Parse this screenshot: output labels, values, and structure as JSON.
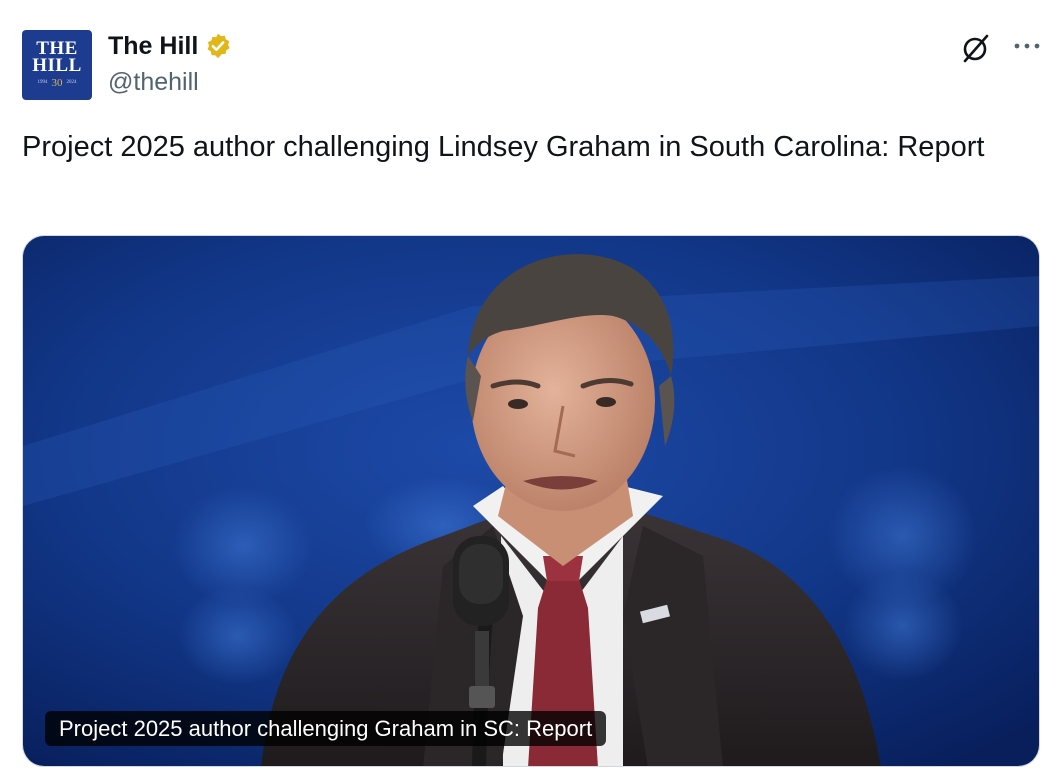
{
  "author": {
    "name": "The Hill",
    "handle": "@thehill",
    "verified": true,
    "avatar": {
      "line1": "THE",
      "line2": "HILL",
      "year_left": "1994",
      "anniversary": "30",
      "year_right": "2024",
      "bg_color": "#1d3c8f"
    }
  },
  "icons": {
    "grok": "grok-icon",
    "more": "more-icon",
    "verified": "verified-badge-icon"
  },
  "tweet": {
    "text": "Project 2025 author challenging Lindsey Graham in South Carolina: Report"
  },
  "media": {
    "caption": "Project 2025 author challenging Graham in SC: Report"
  },
  "colors": {
    "text": "#0f1419",
    "secondary": "#536471",
    "badge": "#e2b719"
  }
}
